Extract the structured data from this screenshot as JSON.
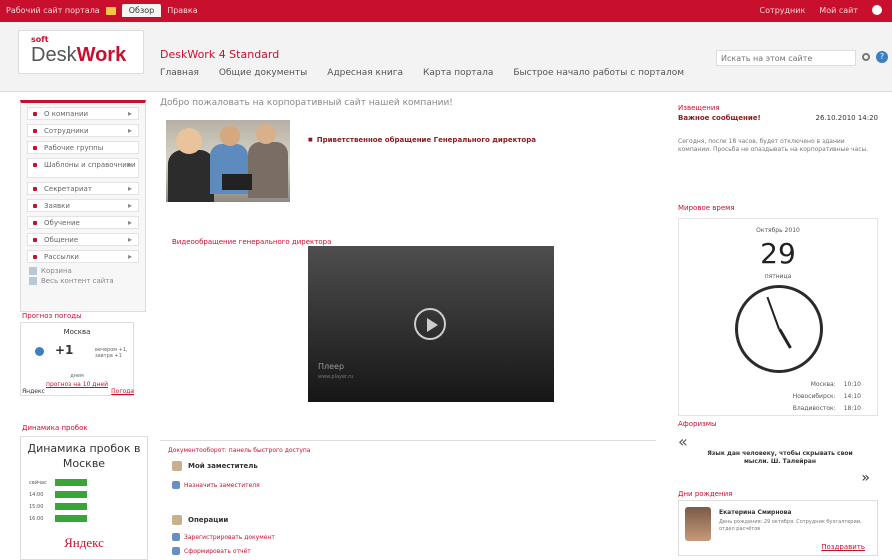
{
  "topbar": {
    "left_link": "Рабочий сайт портала",
    "tab_active": "Обзор",
    "tab_secondary": "Правка",
    "user": "Сотрудник",
    "my_site": "Мой сайт"
  },
  "header": {
    "logo_soft": "soft",
    "logo_desk": "Desk",
    "logo_work": "Work",
    "app_title": "DeskWork 4 Standard",
    "nav": [
      "Главная",
      "Общие документы",
      "Адресная книга",
      "Карта портала",
      "Быстрое начало работы с порталом"
    ],
    "search_placeholder": "Искать на этом сайте"
  },
  "sidebar": {
    "items": [
      {
        "label": "О компании"
      },
      {
        "label": "Сотрудники"
      },
      {
        "label": "Рабочие группы"
      },
      {
        "label": "Шаблоны и справочники"
      },
      {
        "label": "Секретариат"
      },
      {
        "label": "Заявки"
      },
      {
        "label": "Обучение"
      },
      {
        "label": "Общение"
      },
      {
        "label": "Рассылки"
      }
    ],
    "extra": [
      "Корзина",
      "Весь контент сайта"
    ]
  },
  "weather": {
    "title": "Прогноз погоды",
    "city": "Москва",
    "temp": "+1",
    "details": "вечером +1, завтра +1",
    "more_prefix": "днем",
    "more_link": "прогноз на 10 дней",
    "footer_left": "Яндекс",
    "footer_right": "Погода"
  },
  "traffic": {
    "section_title": "Динамика пробок",
    "title": "Динамика пробок в Москве",
    "rows": [
      "сейчас",
      "14:00",
      "15:00",
      "16:00"
    ],
    "brand": "Яндекс"
  },
  "main": {
    "welcome": "Добро пожаловать на корпоративный сайт нашей компании!",
    "greeting_link": "Приветственное обращение Генерального директора",
    "video_title": "Видеообращение генерального директора",
    "video_brand": "Плеер",
    "video_sub": "www.player.ru",
    "quick": {
      "title": "Документооборот: панель быстрого доступа",
      "group1_title": "Мой заместитель",
      "group1_link": "Назначить заместителя",
      "group2_title": "Операции",
      "group2_link1": "Зарегистрировать документ",
      "group2_link2": "Сформировать отчёт"
    }
  },
  "rightcol": {
    "notice_title": "Извещения",
    "notice_heading": "Важное сообщение!",
    "notice_date": "26.10.2010 14:20",
    "notice_text": "Сегодня, после 18 часов, будет отключено в здании компании. Просьба не опаздывать на корпоративные часы.",
    "clock_title": "Мировое время",
    "clock_month": "Октябрь 2010",
    "clock_day": "29",
    "clock_dow": "пятница",
    "tz": [
      {
        "city": "Москва:",
        "time": "10:10"
      },
      {
        "city": "Новосибирск:",
        "time": "14:10"
      },
      {
        "city": "Владивосток:",
        "time": "18:10"
      }
    ],
    "quote_title": "Афоризмы",
    "quote_open": "«",
    "quote_close": "»",
    "quote_text": "Язык дан человеку, чтобы скрывать свои мысли. Ш. Талейран",
    "bday_title": "Дни рождения",
    "bday_name": "Екатерина Смирнова",
    "bday_text": "День рождения: 29 октября. Сотрудник бухгалтерии, отдел расчётов",
    "bday_link": "Поздравить"
  }
}
